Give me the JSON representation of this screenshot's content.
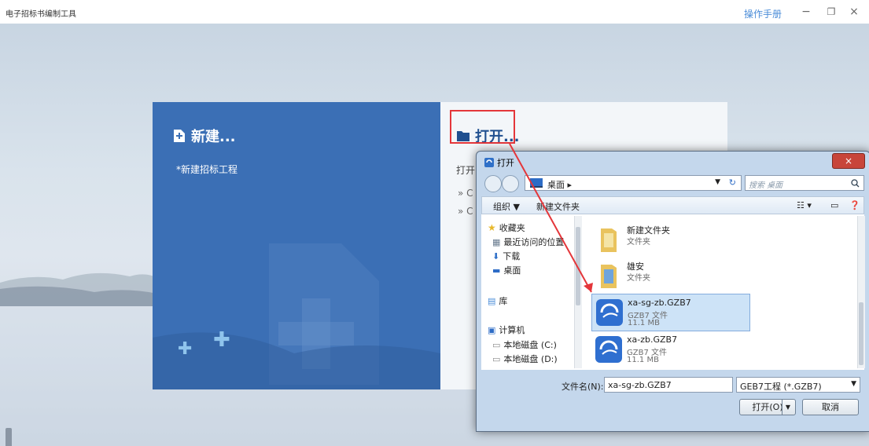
{
  "app": {
    "title": "电子招标书编制工具",
    "manual_link": "操作手册",
    "window_controls": {
      "minimize": "−",
      "restore": "❐",
      "close": "×"
    }
  },
  "new_panel": {
    "title": "新建...",
    "link": "*新建招标工程"
  },
  "open_panel": {
    "title": "打开...",
    "desc": "打开",
    "recent_items": [
      "» C",
      "» C"
    ]
  },
  "dialog": {
    "title": "打开",
    "close": "×",
    "breadcrumb": "桌面 ▸",
    "search_placeholder": "搜索 桌面",
    "toolbar": {
      "organize": "组织 ▼",
      "new_folder": "新建文件夹"
    },
    "tree": {
      "favorites": "收藏夹",
      "recent_places": "最近访问的位置",
      "downloads": "下载",
      "desktop": "桌面",
      "libraries": "库",
      "computer": "计算机",
      "disk_c": "本地磁盘 (C:)",
      "disk_d": "本地磁盘 (D:)"
    },
    "files": [
      {
        "name": "新建文件夹",
        "type": "文件夹",
        "size": ""
      },
      {
        "name": "雄安",
        "type": "文件夹",
        "size": ""
      },
      {
        "name": "xa-sg-zb.GZB7",
        "type": "GZB7 文件",
        "size": "11.1 MB"
      },
      {
        "name": "xa-zb.GZB7",
        "type": "GZB7 文件",
        "size": "11.1 MB"
      }
    ],
    "filename_label": "文件名(N):",
    "filename_value": "xa-sg-zb.GZB7",
    "filetype_value": "GEB7工程 (*.GZB7)",
    "open_button": "打开(O)",
    "cancel_button": "取消"
  },
  "colors": {
    "accent": "#3b6fb5",
    "highlight": "#e4363a",
    "link": "#4a8cd8"
  }
}
